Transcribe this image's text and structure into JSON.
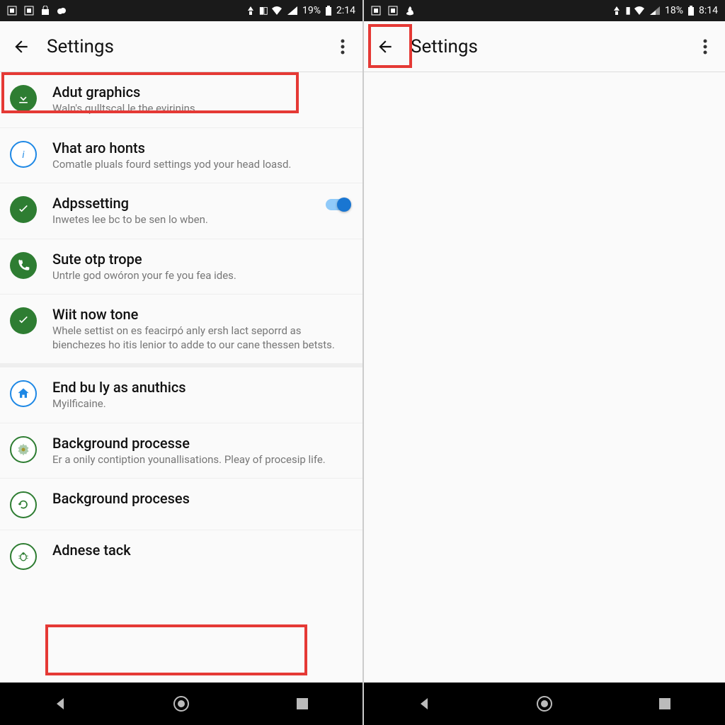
{
  "left": {
    "status": {
      "battery": "19%",
      "time": "2:14"
    },
    "title": "Settings",
    "items": [
      {
        "title": "Adut graphics",
        "sub": "Waln's qulltscal le the evirinins",
        "icon": "download",
        "iconStyle": "green-solid"
      },
      {
        "title": "Vhat aro honts",
        "sub": "Comatle pluals fourd settings yod your head loasd.",
        "icon": "info",
        "iconStyle": "blue-ring"
      },
      {
        "title": "Adpssetting",
        "sub": "Inwetes lee bc to be sen lo wben.",
        "icon": "check",
        "iconStyle": "green-solid",
        "toggle": true
      },
      {
        "title": "Sute otp trope",
        "sub": "Untrle god owóron your fe you fea ides.",
        "icon": "phone",
        "iconStyle": "green-solid"
      },
      {
        "title": "Wiit now tone",
        "sub": "Whele settist on es feacirpó anly ersh lact seporrd as bienchezes ho itis lenior to adde to our cane thessen betsts.",
        "icon": "check",
        "iconStyle": "green-solid"
      },
      {
        "title": "End bu ly as anuthics",
        "sub": "Myilficaine.",
        "icon": "house",
        "iconStyle": "blue-ring",
        "groupBreak": true
      },
      {
        "title": "Background processe",
        "sub": "Er a onily contiption younallisations. Pleay of procesip life.",
        "icon": "gear",
        "iconStyle": "green-ring"
      },
      {
        "title": "Background proceses",
        "sub": "",
        "icon": "refresh",
        "iconStyle": "green-ring"
      },
      {
        "title": "Adnese tack",
        "sub": "",
        "icon": "bug",
        "iconStyle": "green-ring"
      }
    ]
  },
  "right": {
    "status": {
      "battery": "18%",
      "time": "8:14"
    },
    "title": "Settings"
  }
}
